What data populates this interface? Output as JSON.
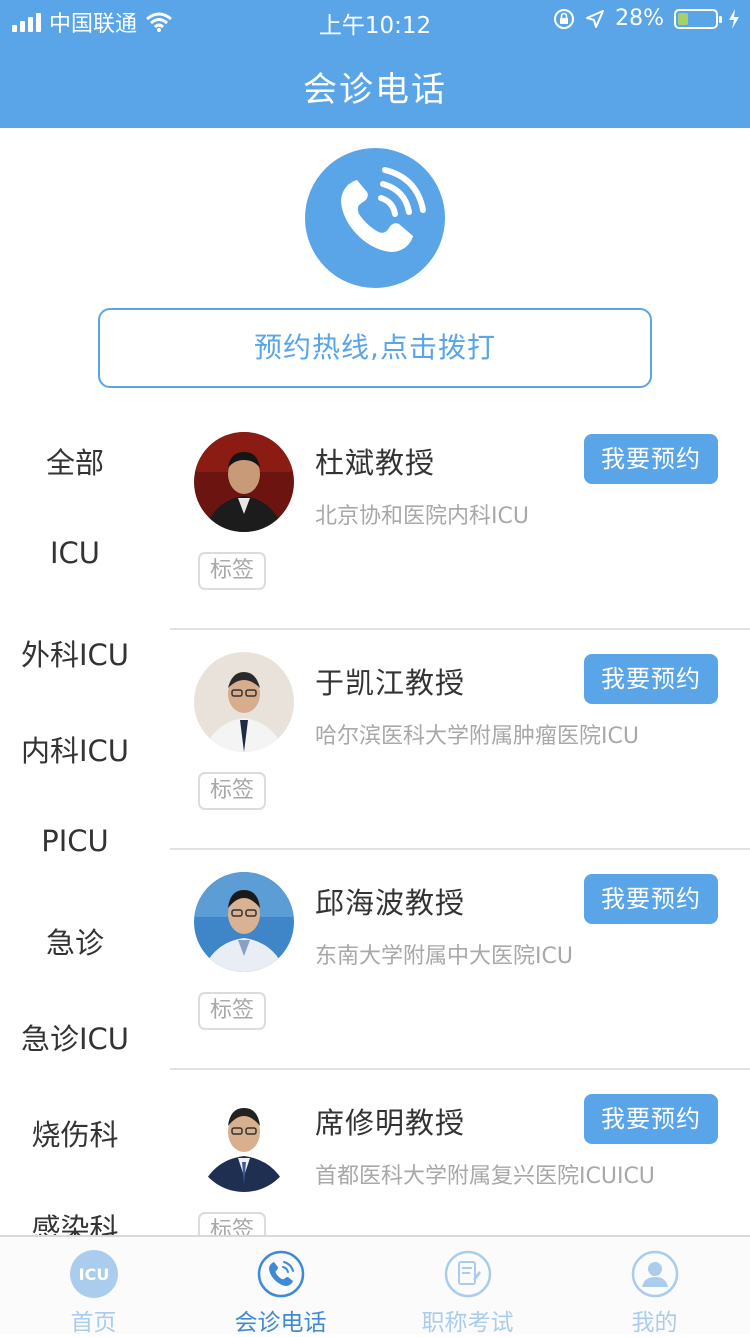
{
  "status_bar": {
    "carrier": "中国联通",
    "time": "上午10:12",
    "battery": "28%",
    "battery_level": 0.28
  },
  "header": {
    "title": "会诊电话"
  },
  "hotline": {
    "label": "预约热线,点击拨打"
  },
  "categories": [
    "全部",
    "ICU",
    "外科ICU",
    "内科ICU",
    "PICU",
    "急诊",
    "急诊ICU",
    "烧伤科",
    "感染科"
  ],
  "doctors": [
    {
      "name": "杜斌教授",
      "hospital": "北京协和医院内科ICU",
      "button": "我要预约",
      "tag": "标签"
    },
    {
      "name": "于凯江教授",
      "hospital": "哈尔滨医科大学附属肿瘤医院ICU",
      "button": "我要预约",
      "tag": "标签"
    },
    {
      "name": "邱海波教授",
      "hospital": "东南大学附属中大医院ICU",
      "button": "我要预约",
      "tag": "标签"
    },
    {
      "name": "席修明教授",
      "hospital": "首都医科大学附属复兴医院ICUICU",
      "button": "我要预约",
      "tag": "标签"
    }
  ],
  "tabbar": [
    {
      "label": "首页",
      "icon": "icu-logo-icon",
      "active": false
    },
    {
      "label": "会诊电话",
      "icon": "phone-icon",
      "active": true
    },
    {
      "label": "职称考试",
      "icon": "exam-icon",
      "active": false
    },
    {
      "label": "我的",
      "icon": "user-icon",
      "active": false
    }
  ],
  "colors": {
    "primary": "#5aa5e8",
    "active_tab": "#3f8ad6",
    "inactive_tab": "#aacdee"
  }
}
